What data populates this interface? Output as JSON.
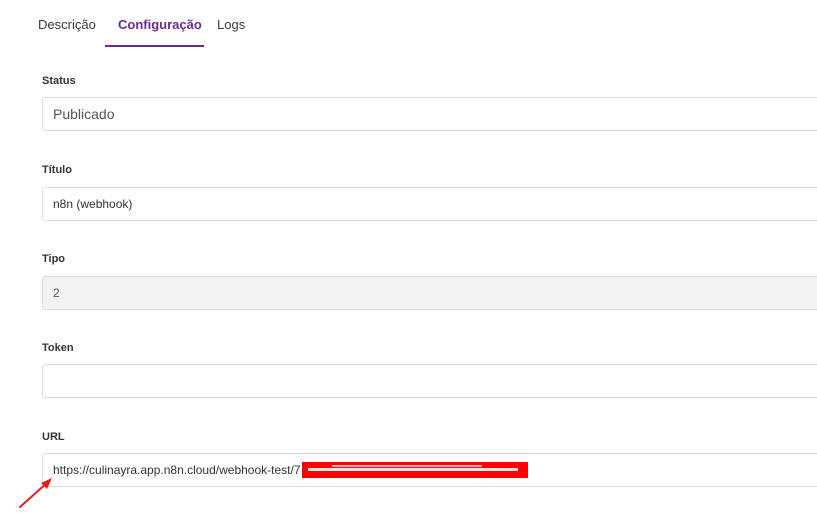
{
  "tabs": [
    {
      "label": "Descrição",
      "active": false
    },
    {
      "label": "Configuração",
      "active": true
    },
    {
      "label": "Logs",
      "active": false
    }
  ],
  "form": {
    "status": {
      "label": "Status",
      "value": "Publicado"
    },
    "title": {
      "label": "Título",
      "value": "n8n (webhook)"
    },
    "type": {
      "label": "Tipo",
      "value": "2"
    },
    "token": {
      "label": "Token",
      "value": ""
    },
    "url": {
      "label": "URL",
      "value": "https://culinayra.app.n8n.cloud/webhook-test/7"
    }
  },
  "colors": {
    "accent": "#6b2c91",
    "redaction": "#ff0000",
    "annotation_arrow": "#e02020"
  },
  "icons": {
    "annotation": "arrow-annotation-icon"
  }
}
